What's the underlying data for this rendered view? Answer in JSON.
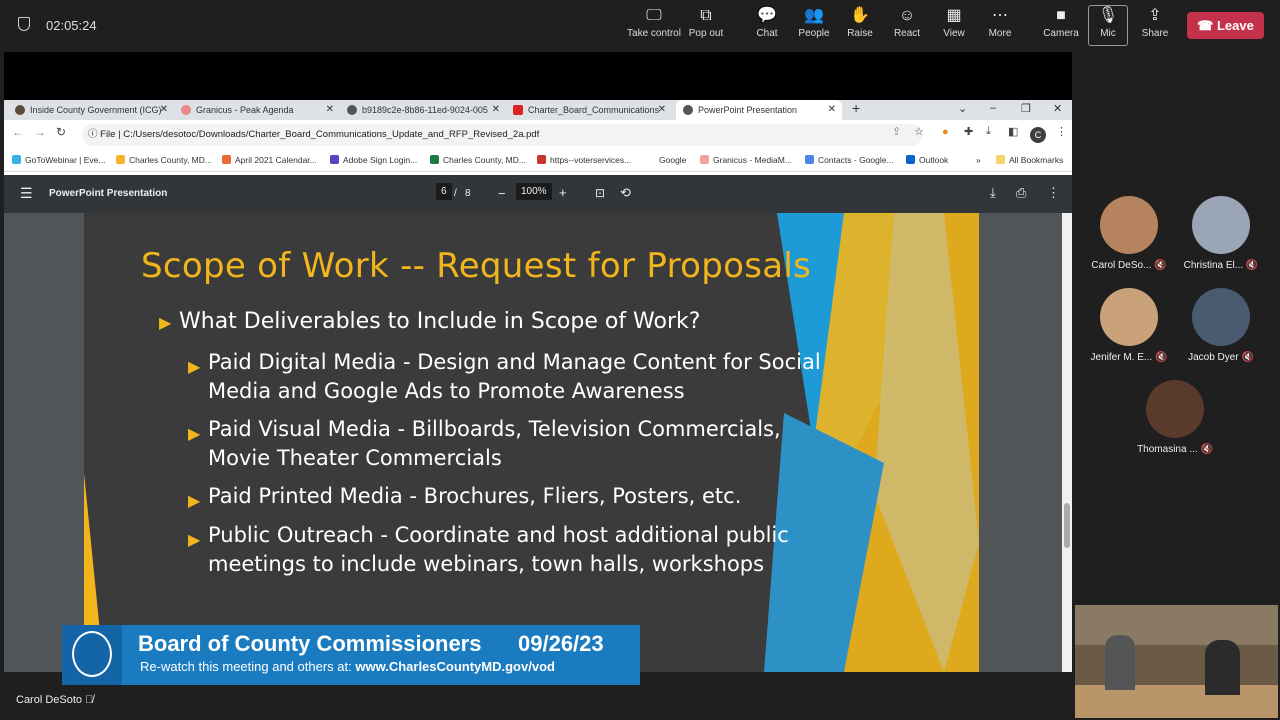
{
  "meeting": {
    "timer": "02:05:24",
    "controls": [
      {
        "id": "take-control",
        "label": "Take control",
        "icon": "🖵"
      },
      {
        "id": "pop-out",
        "label": "Pop out",
        "icon": "⧉"
      },
      {
        "id": "chat",
        "label": "Chat",
        "icon": "💬"
      },
      {
        "id": "people",
        "label": "People",
        "icon": "👥"
      },
      {
        "id": "raise",
        "label": "Raise",
        "icon": "✋"
      },
      {
        "id": "react",
        "label": "React",
        "icon": "☺"
      },
      {
        "id": "view",
        "label": "View",
        "icon": "▦"
      },
      {
        "id": "more",
        "label": "More",
        "icon": "⋯"
      },
      {
        "id": "camera",
        "label": "Camera",
        "icon": "■"
      },
      {
        "id": "mic",
        "label": "Mic",
        "icon": "🎙"
      },
      {
        "id": "share",
        "label": "Share",
        "icon": "⇪"
      }
    ],
    "leave": "Leave",
    "presenter": "Carol DeSoto",
    "participants": [
      "Carol DeSo...",
      "Christina El...",
      "Jenifer M. E...",
      "Jacob Dyer",
      "Thomasina ..."
    ]
  },
  "browser": {
    "tabs": [
      "Inside County Government (ICG)",
      "Granicus - Peak Agenda",
      "b9189c2e-8b86-11ed-9024-005",
      "Charter_Board_Communications",
      "PowerPoint Presentation"
    ],
    "url_prefix": "File",
    "url": "C:/Users/desotoc/Downloads/Charter_Board_Communications_Update_and_RFP_Revised_2a.pdf",
    "profile": "C",
    "bookmarks": [
      "GoToWebinar | Eve...",
      "Charles County, MD...",
      "April 2021 Calendar...",
      "Adobe Sign Login...",
      "Charles County, MD...",
      "https--voterservices...",
      "Google",
      "Granicus - MediaM...",
      "Contacts - Google...",
      "Outlook",
      "»",
      "All Bookmarks"
    ]
  },
  "pdf": {
    "title": "PowerPoint Presentation",
    "page": "6",
    "total": "8",
    "zoom": "100%"
  },
  "slide": {
    "title": "Scope of Work -- Request for Proposals",
    "bullet": "What Deliverables to Include in Scope of Work?",
    "subs": [
      "Paid Digital Media - Design and Manage Content for Social Media and Google Ads to Promote Awareness",
      "Paid Visual Media - Billboards, Television Commercials, Movie Theater Commercials",
      "Paid Printed Media - Brochures, Fliers, Posters, etc.",
      "Public Outreach - Coordinate and host additional public meetings to include webinars, town halls, workshops"
    ]
  },
  "banner": {
    "title": "Board of County Commissioners",
    "date": "09/26/23",
    "sub": "Re-watch this meeting and others at:",
    "link": "www.CharlesCountyMD.gov/vod"
  }
}
